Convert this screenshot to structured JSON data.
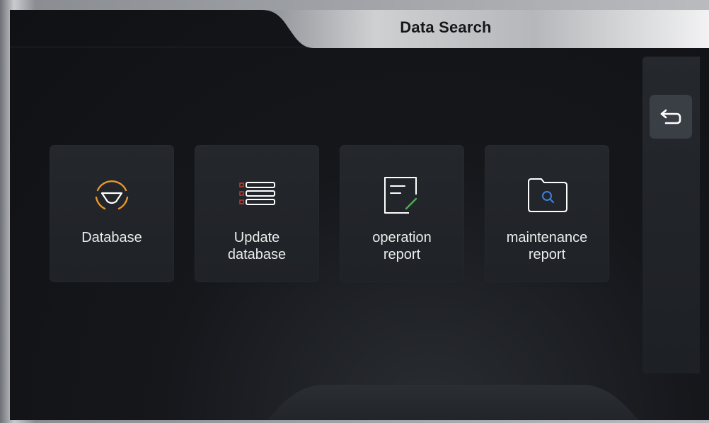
{
  "header": {
    "title": "Data Search"
  },
  "side_panel": {
    "back_icon": "return-arrow-icon"
  },
  "tiles": [
    {
      "label_line1": "Database",
      "label_line2": "",
      "icon": "steering-wheel-icon",
      "accent": "#e8962a"
    },
    {
      "label_line1": "Update",
      "label_line2": "database",
      "icon": "list-icon",
      "accent": "#c0392b"
    },
    {
      "label_line1": "operation",
      "label_line2": "report",
      "icon": "edit-document-icon",
      "accent": "#4caf50"
    },
    {
      "label_line1": "maintenance",
      "label_line2": "report",
      "icon": "folder-search-icon",
      "accent": "#3d7fe0"
    }
  ],
  "colors": {
    "background": "#0f1114",
    "tile": "#23262b",
    "title_tab": "#e6e7e8",
    "text": "#ececec"
  }
}
